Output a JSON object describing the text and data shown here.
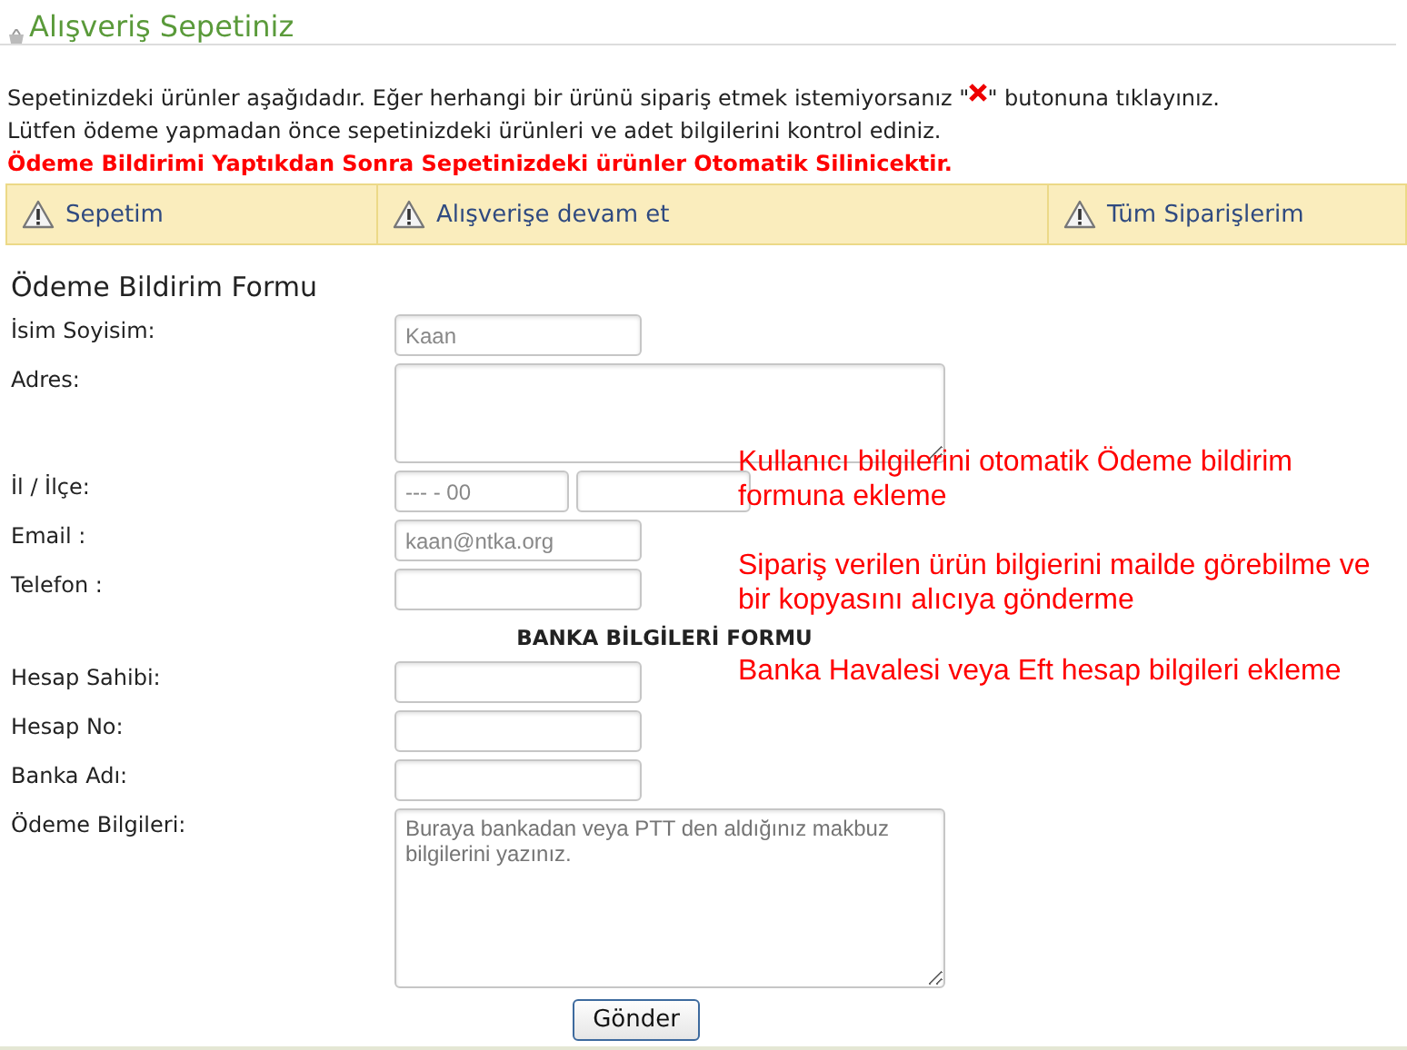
{
  "page_title": "Alışveriş Sepetiniz",
  "intro": {
    "line_1_before": "Sepetinizdeki ürünler aşağıdadır. Eğer herhangi bir ürünü sipariş etmek istemiyorsanız \"",
    "line_1_after": "\" butonuna tıklayınız.",
    "line_2": "Lütfen ödeme yapmadan önce sepetinizdeki ürünleri ve adet bilgilerini kontrol ediniz.",
    "warning": "Ödeme Bildirimi Yaptıkdan Sonra Sepetinizdeki ürünler Otomatik Silinicektir."
  },
  "tabs": [
    {
      "label": "Sepetim"
    },
    {
      "label": "Alışverişe devam et"
    },
    {
      "label": "Tüm Siparişlerim"
    }
  ],
  "form": {
    "title": "Ödeme Bildirim Formu",
    "rows": [
      {
        "kind": "input",
        "label": "İsim Soyisim:",
        "value": "Kaan"
      },
      {
        "kind": "textarea",
        "label": "Adres:"
      },
      {
        "kind": "pair",
        "label": "İl / İlçe:",
        "value": "--- - 00"
      },
      {
        "kind": "input",
        "label": "Email :",
        "value": "kaan@ntka.org"
      },
      {
        "kind": "input",
        "label": "Telefon :"
      },
      {
        "kind": "heading",
        "label": "BANKA BİLGİLERİ FORMU"
      },
      {
        "kind": "input",
        "label": "Hesap Sahibi:"
      },
      {
        "kind": "input",
        "label": "Hesap No:"
      },
      {
        "kind": "input",
        "label": "Banka Adı:"
      },
      {
        "kind": "bigarea",
        "label": "Ödeme Bilgileri:",
        "placeholder": "Buraya bankadan veya PTT den aldığınız makbuz bilgilerini yazınız."
      }
    ],
    "submit": "Gönder"
  },
  "annotations": [
    "Kullanıcı bilgilerini otomatik Ödeme bildirim formuna ekleme",
    "Sipariş verilen ürün bilgierini mailde görebilme ve bir kopyasını alıcıya gönderme",
    "Banka Havalesi veya Eft hesap bilgileri ekleme"
  ]
}
